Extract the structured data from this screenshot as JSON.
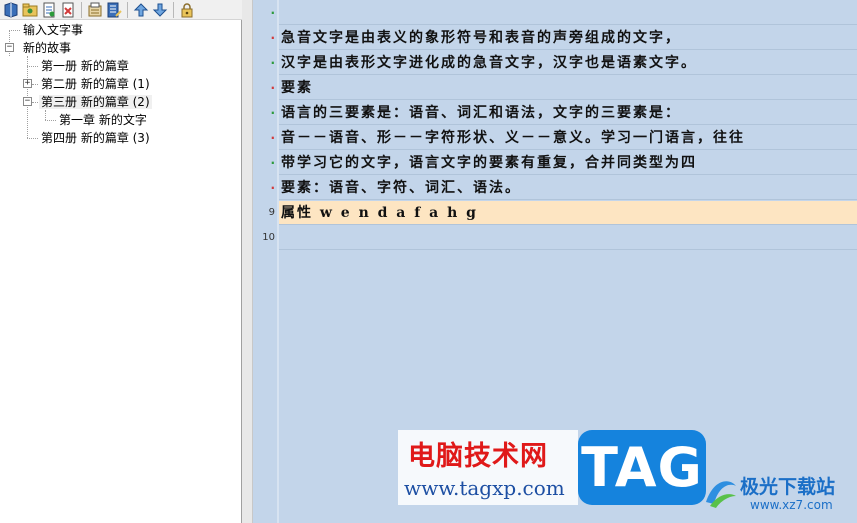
{
  "toolbar": {
    "buttons": [
      "book-icon",
      "folder-open-icon",
      "new-document-icon",
      "delete-icon",
      "properties-icon",
      "edit-icon",
      "move-up-icon",
      "move-down-icon",
      "lock-icon"
    ]
  },
  "tree": {
    "nodes": [
      {
        "label": "输入文字事"
      },
      {
        "label": "新的故事"
      },
      {
        "label": "第一册 新的篇章"
      },
      {
        "label": "第二册 新的篇章 (1)"
      },
      {
        "label": "第三册 新的篇章 (2)"
      },
      {
        "label": "第一章 新的文字"
      },
      {
        "label": "第四册 新的篇章 (3)"
      }
    ],
    "expander_plus": "+",
    "expander_minus": "−"
  },
  "editor": {
    "gutter": [
      "·",
      "·",
      "·",
      "·",
      "·",
      "·",
      "·",
      "·",
      "9",
      "10"
    ],
    "lines": [
      "",
      "急音文字是由表义的象形符号和表音的声旁组成的文字，",
      "汉字是由表形文字进化成的急音文字，汉字也是语素文字。",
      "要素",
      "语言的三要素是：语音、词汇和语法，文字的三要素是：",
      "音－－语音、形－－字符形状、义－－意义。学习一门语言，往往",
      "带学习它的文字，语言文字的要素有重复，合并同类型为四",
      "要素：语音、字符、词汇、语法。",
      "属性  w e n d a f a h g",
      ""
    ],
    "current_line": 9
  },
  "watermark": {
    "title": "电脑技术网",
    "url": "www.tagxp.com",
    "tag": "TAG",
    "site2_title": "极光下载站",
    "site2_url": "www.xz7.com"
  },
  "colors": {
    "editor_bg": "#c3d5ea",
    "current_line_bg": "#fde5c2",
    "gutter_red": "#d23a3a",
    "gutter_green": "#2c9a3a",
    "tag_blue": "#1583dd",
    "watermark_red": "#e01919"
  }
}
